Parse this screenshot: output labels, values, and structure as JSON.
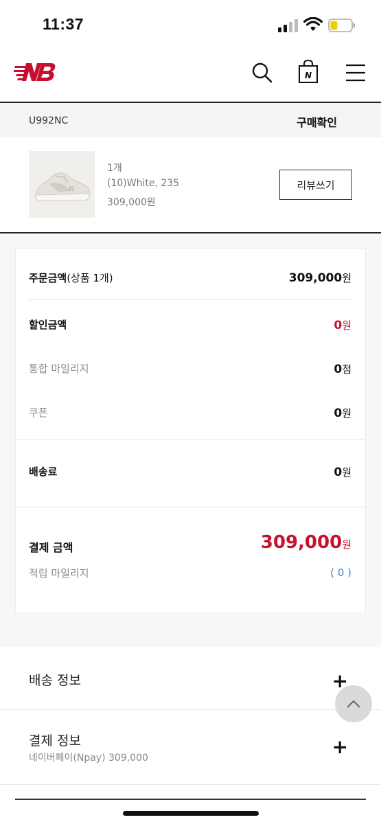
{
  "status_bar": {
    "time": "11:37"
  },
  "header": {
    "logo_icon": "new-balance-logo",
    "icons": [
      "search-icon",
      "shopping-bag-icon",
      "hamburger-menu-icon"
    ]
  },
  "order": {
    "code": "U992NC",
    "status": "구매확인"
  },
  "product": {
    "quantity": "1개",
    "option": "(10)White, 235",
    "price": "309,000원",
    "review_button": "리뷰쓰기"
  },
  "summary": {
    "order_amount_label": "주문금액",
    "order_amount_sub": "(상품 1개)",
    "order_amount_value": "309,000",
    "discount_label": "할인금액",
    "discount_value": "0",
    "mileage_label": "통합 마일리지",
    "mileage_value": "0",
    "mileage_unit": "점",
    "coupon_label": "쿠폰",
    "coupon_value": "0",
    "shipping_label": "배송료",
    "shipping_value": "0",
    "total_label": "결제 금액",
    "total_value": "309,000",
    "earned_label": "적립 마일리지",
    "earned_value": "( 0 )",
    "won": "원"
  },
  "accordions": {
    "shipping_info": "배송 정보",
    "payment_info": "결제 정보",
    "payment_method": "네이버페이(Npay) 309,000"
  },
  "colors": {
    "accent_red": "#c8102e",
    "link_blue": "#3f86c4"
  }
}
